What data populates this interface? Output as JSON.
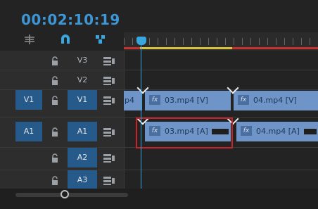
{
  "timecode": "00:02:10:19",
  "tracks": {
    "v3": {
      "name": "V3"
    },
    "v2": {
      "name": "V2"
    },
    "v1": {
      "source": "V1",
      "name": "V1"
    },
    "a1": {
      "source": "A1",
      "name": "A1"
    },
    "a2": {
      "name": "A2"
    },
    "a3": {
      "name": "A3"
    }
  },
  "clips": {
    "v_prev": {
      "label": "p4"
    },
    "v1_03": {
      "label": "03.mp4 [V]",
      "fx": "fx"
    },
    "v1_04": {
      "label": "04.mp4 [V]",
      "fx": "fx"
    },
    "a1_03": {
      "label": "03.mp4 [A]",
      "fx": "fx"
    },
    "a1_04": {
      "label": "04.mp4 [A]",
      "fx": "fx"
    }
  },
  "icons": {
    "insert": "insert-icon",
    "snap": "snap-magnet-icon",
    "linked": "linked-selection-icon",
    "lock": "lock-icon",
    "toggle": "toggle-output-icon"
  },
  "colors": {
    "accent": "#3d96d6",
    "track_active": "#255a8a",
    "clip": "#6f95c8",
    "selection": "#c6242a",
    "work_area": "#d6c33a",
    "render_red": "#c82f2f"
  }
}
